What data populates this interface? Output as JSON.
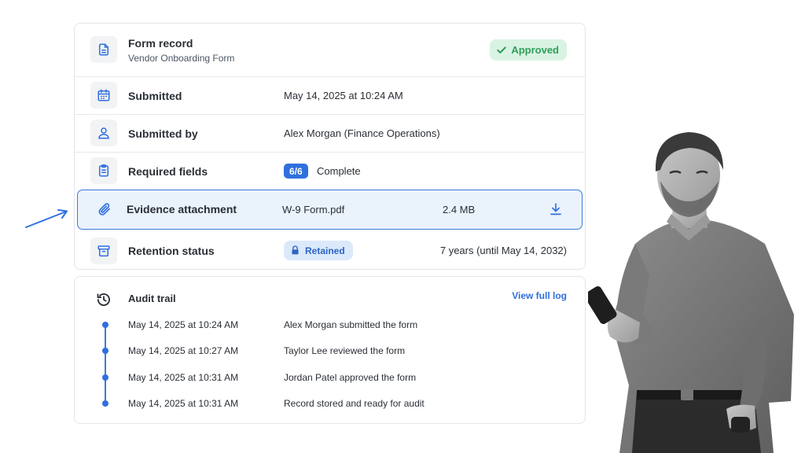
{
  "form": {
    "title": "Form record",
    "subtitle": "Vendor Onboarding Form",
    "status": "Approved"
  },
  "details": {
    "submitted_label": "Submitted",
    "submitted_value": "May 14, 2025 at 10:24 AM",
    "submitted_by_label": "Submitted by",
    "submitted_by_value": "Alex Morgan (Finance Operations)",
    "required_label": "Required fields",
    "required_count": "6/6",
    "required_status": "Complete",
    "attachment_label": "Evidence attachment",
    "attachment_file": "W-9 Form.pdf",
    "attachment_size": "2.4 MB",
    "retention_label": "Retention status",
    "retention_badge": "Retained",
    "retention_period": "7 years (until May 14, 2032)"
  },
  "audit": {
    "title": "Audit trail",
    "view_link": "View full log",
    "entries": [
      {
        "time": "May 14, 2025 at 10:24 AM",
        "event": "Alex Morgan submitted the form"
      },
      {
        "time": "May 14, 2025 at 10:27 AM",
        "event": "Taylor Lee reviewed the form"
      },
      {
        "time": "May 14, 2025 at 10:31 AM",
        "event": "Jordan Patel approved the form"
      },
      {
        "time": "May 14, 2025 at 10:31 AM",
        "event": "Record stored and ready for audit"
      }
    ]
  },
  "colors": {
    "accent": "#2f6fde",
    "success": "#2e9e58",
    "highlight_bg": "#eaf2fc"
  },
  "icons": {
    "form": "document-icon",
    "submitted": "calendar-icon",
    "submitted_by": "user-icon",
    "required": "clipboard-icon",
    "attachment": "paperclip-icon",
    "retention": "archive-icon",
    "audit": "history-icon",
    "download": "download-icon",
    "lock": "lock-icon",
    "check": "check-icon"
  }
}
